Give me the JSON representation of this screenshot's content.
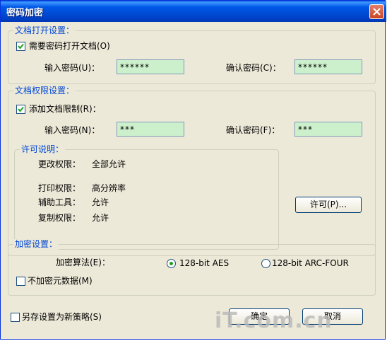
{
  "window": {
    "title": "密码加密"
  },
  "open_group": {
    "legend": "文档打开设置：",
    "require_password_label": "需要密码打开文档(O)",
    "require_password_checked": true,
    "input_label": "输入密码(U)：",
    "input_value": "******",
    "confirm_label": "确认密码(C)：",
    "confirm_value": "******"
  },
  "perm_group": {
    "legend": "文档权限设置：",
    "add_restriction_label": "添加文档限制(R)：",
    "add_restriction_checked": true,
    "input_label": "输入密码(N)：",
    "input_value": "***",
    "confirm_label": "确认密码(F)：",
    "confirm_value": "***",
    "license": {
      "legend": "许可说明：",
      "rows": [
        {
          "label": "更改权限：",
          "value": "全部允许"
        },
        {
          "label": "打印权限：",
          "value": "高分辨率"
        },
        {
          "label": "辅助工具：",
          "value": "允许"
        },
        {
          "label": "复制权限：",
          "value": "允许"
        }
      ]
    },
    "permit_button": "许可(P)..."
  },
  "enc_group": {
    "legend": "加密设置：",
    "algo_label": "加密算法(E)：",
    "aes_label": "128-bit AES",
    "aes_selected": true,
    "arcfour_label": "128-bit ARC-FOUR",
    "no_meta_label": "不加密元数据(M)",
    "no_meta_checked": false
  },
  "footer": {
    "save_policy_label": "另存设置为新策略(S)",
    "save_policy_checked": false,
    "ok_label": "确定",
    "cancel_label": "取消"
  },
  "watermark": "iT.com.cn"
}
